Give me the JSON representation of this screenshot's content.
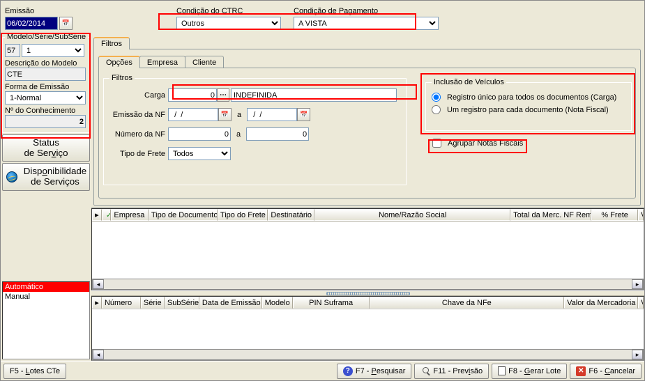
{
  "top": {
    "emissao_label": "Emissão",
    "emissao_value": "06/02/2014",
    "cond_ctrc_label": "Condição do CTRC",
    "cond_ctrc_value": "Outros",
    "cond_pag_label": "Condição de Pagamento",
    "cond_pag_value": "A VISTA"
  },
  "sidebar": {
    "modelo_legend": "Modelo/Série/SubSérie",
    "modelo_value": "57",
    "serie_value": "1",
    "descr_modelo_label": "Descrição do Modelo",
    "descr_modelo_value": "CTE",
    "forma_emissao_label": "Forma de Emissão",
    "forma_emissao_value": "1-Normal",
    "num_conhec_label": "Nº do Conhecimento",
    "num_conhec_value": "2",
    "status_btn": "Status\nde Serviço",
    "disp_btn": "Disponibilidade\nde Serviços",
    "list_auto": "Automático",
    "list_manual": "Manual"
  },
  "tabs": {
    "filtros": "Filtros",
    "opcoes": "Opções",
    "empresa": "Empresa",
    "cliente": "Cliente"
  },
  "filtros": {
    "legend": "Filtros",
    "carga_label": "Carga",
    "carga_value": "0",
    "carga_desc": "INDEFINIDA",
    "emissao_nf_label": "Emissão da NF",
    "emissao_de": "  /  /",
    "a": "a",
    "emissao_ate": "  /  /",
    "numero_nf_label": "Número da NF",
    "numero_nf_de": "0",
    "numero_nf_ate": "0",
    "tipo_frete_label": "Tipo de Frete",
    "tipo_frete_value": "Todos"
  },
  "veic": {
    "legend": "Inclusão de Veículos",
    "opt1": "Registro único para todos os documentos (Carga)",
    "opt2": "Um registro para cada documento (Nota Fiscal)",
    "agrupar": "Agrupar Notas Fiscais"
  },
  "grid1_headers": [
    "",
    "",
    "Empresa",
    "Tipo de Documento",
    "Tipo do Frete",
    "Destinatário",
    "Nome/Razão Social",
    "Total da Merc. NF Rem.",
    "% Frete",
    "Valor d"
  ],
  "grid2_headers": [
    "",
    "Número",
    "Série",
    "SubSérie",
    "Data de Emissão",
    "Modelo",
    "PIN Suframa",
    "Chave da NFe",
    "Valor da Mercadoria",
    "Val"
  ],
  "status": {
    "f5": "F5 - Lotes CTe",
    "f7": "F7 - Pesquisar",
    "f11": "F11 - Previsão",
    "f8": "F8 - Gerar Lote",
    "f6": "F6 - Cancelar"
  }
}
